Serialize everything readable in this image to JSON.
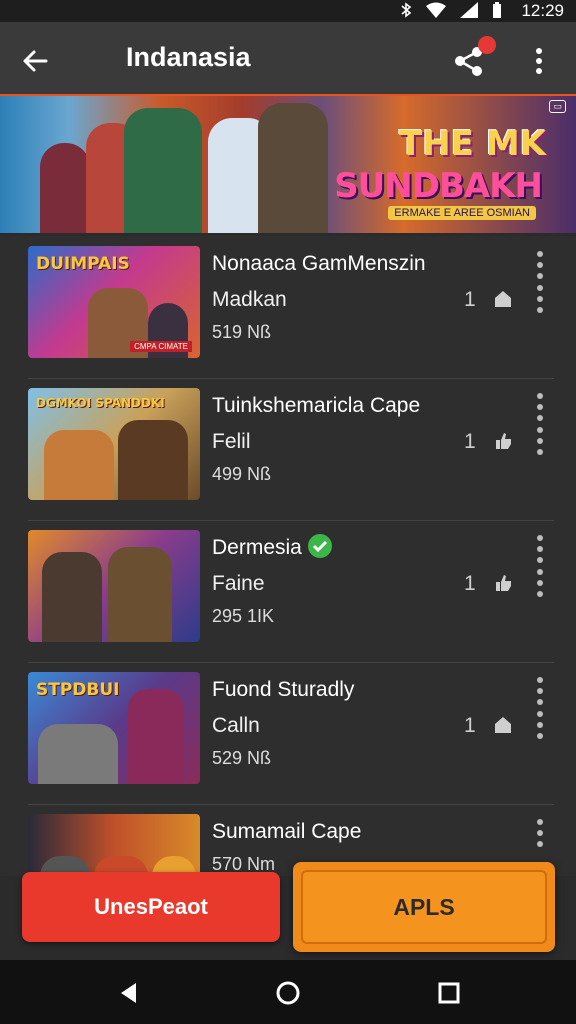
{
  "status": {
    "time": "12:29"
  },
  "app_bar": {
    "title": "Indanasia"
  },
  "banner": {
    "line1": "THE MK",
    "line2": "SUNDBAKH",
    "caption": "ERMAKE E AREE OSMIAN"
  },
  "items": [
    {
      "title": "Nonaaca GamMenszin",
      "sub": "Madkan",
      "meta": "519 Nß",
      "count": "1",
      "thumb_text": "DUIMPAIS",
      "thumb_caption": "CMPA CIMATE"
    },
    {
      "title": "Tuinkshemaricla Cape",
      "sub": "Felil",
      "meta": "499 Nß",
      "count": "1",
      "thumb_text": "DGMKOI SPANDDKI"
    },
    {
      "title": "Dermesia",
      "sub": "Faine",
      "meta": "295 1IK",
      "count": "1",
      "verified": true
    },
    {
      "title": "Fuond Sturadly",
      "sub": "Calln",
      "meta": "529 Nß",
      "count": "1",
      "thumb_text": "STPDBUI"
    },
    {
      "title": "Sumamail Cape",
      "sub": "",
      "meta": "570 Nm",
      "count": ""
    }
  ],
  "buttons": {
    "left": "UnesPeaot",
    "right": "APLS"
  },
  "colors": {
    "accent": "#e8551f",
    "red_button": "#e8392c",
    "orange_button": "#f5931f",
    "verified": "#3cb549"
  }
}
